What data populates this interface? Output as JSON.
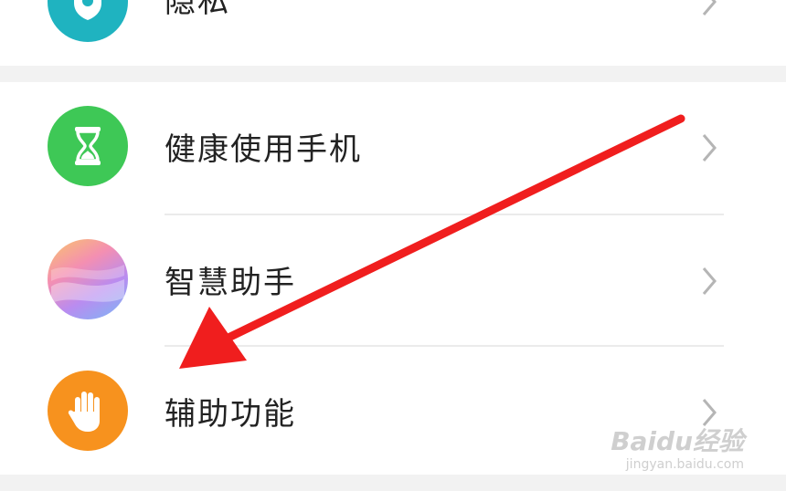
{
  "rows": {
    "privacy": {
      "label": "隐私",
      "icon": "privacy-icon",
      "color": "#1fb3c0"
    },
    "digital_balance": {
      "label": "健康使用手机",
      "icon": "hourglass-icon",
      "color": "#3ec856"
    },
    "smart_assistant": {
      "label": "智慧助手",
      "icon": "assistant-gradient-icon"
    },
    "accessibility": {
      "label": "辅助功能",
      "icon": "hand-icon",
      "color": "#f7921e"
    }
  },
  "annotation": {
    "color": "#f01e1e"
  },
  "watermark": {
    "brand": "Baidu经验",
    "url": "jingyan.baidu.com"
  }
}
